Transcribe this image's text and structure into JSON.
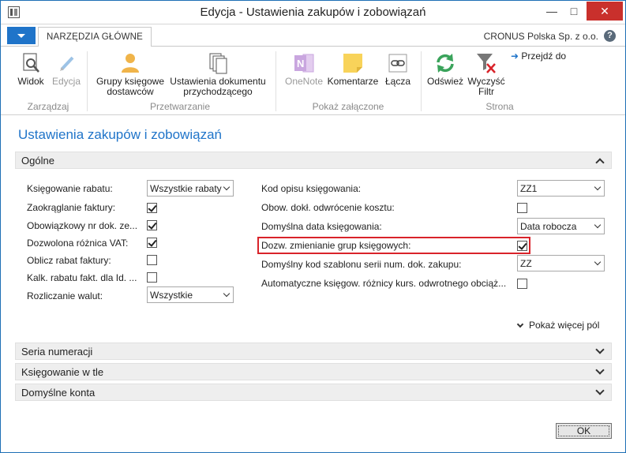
{
  "window": {
    "title": "Edycja - Ustawienia zakupów i zobowiązań"
  },
  "tabs": {
    "home_label": "NARZĘDZIA GŁÓWNE",
    "company": "CRONUS Polska Sp. z o.o.",
    "help": "?"
  },
  "ribbon": {
    "groups": [
      {
        "label": "Zarządzaj"
      },
      {
        "label": "Przetwarzanie"
      },
      {
        "label": "Pokaż załączone"
      },
      {
        "label": "Strona"
      }
    ],
    "buttons": {
      "view": "Widok",
      "edit": "Edycja",
      "vendor_groups_1": "Grupy księgowe",
      "vendor_groups_2": "dostawców",
      "doc_setup_1": "Ustawienia dokumentu",
      "doc_setup_2": "przychodzącego",
      "onenote": "OneNote",
      "comments": "Komentarze",
      "links": "Łącza",
      "refresh": "Odśwież",
      "clear_filter_1": "Wyczyść",
      "clear_filter_2": "Filtr",
      "goto": "Przejdź do"
    }
  },
  "page": {
    "title": "Ustawienia zakupów i zobowiązań"
  },
  "general": {
    "tab_label": "Ogólne",
    "left": [
      {
        "label": "Księgowanie rabatu:",
        "value": "Wszystkie rabaty"
      },
      {
        "label": "Zaokrąglanie faktury:"
      },
      {
        "label": "Obowiązkowy nr dok. ze..."
      },
      {
        "label": "Dozwolona różnica VAT:"
      },
      {
        "label": "Oblicz rabat faktury:"
      },
      {
        "label": "Kalk. rabatu fakt. dla Id. ..."
      },
      {
        "label": "Rozliczanie walut:",
        "value": "Wszystkie"
      }
    ],
    "right": [
      {
        "label": "Kod opisu księgowania:",
        "value": "ZZ1"
      },
      {
        "label": "Obow. dokł. odwrócenie kosztu:"
      },
      {
        "label": "Domyślna data księgowania:",
        "value": "Data robocza"
      },
      {
        "label": "Dozw. zmienianie grup księgowych:"
      },
      {
        "label": "Domyślny kod szablonu serii num. dok. zakupu:",
        "value": "ZZ"
      },
      {
        "label": "Automatyczne księgow. różnicy kurs. odwrotnego obciąż..."
      }
    ],
    "show_more": "Pokaż więcej pól"
  },
  "fasttabs": {
    "numbering": "Seria numeracji",
    "background_posting": "Księgowanie w tle",
    "default_accounts": "Domyślne konta"
  },
  "footer": {
    "ok": "OK"
  },
  "colors": {
    "accent": "#1f74c9",
    "highlight": "#d9232a"
  }
}
